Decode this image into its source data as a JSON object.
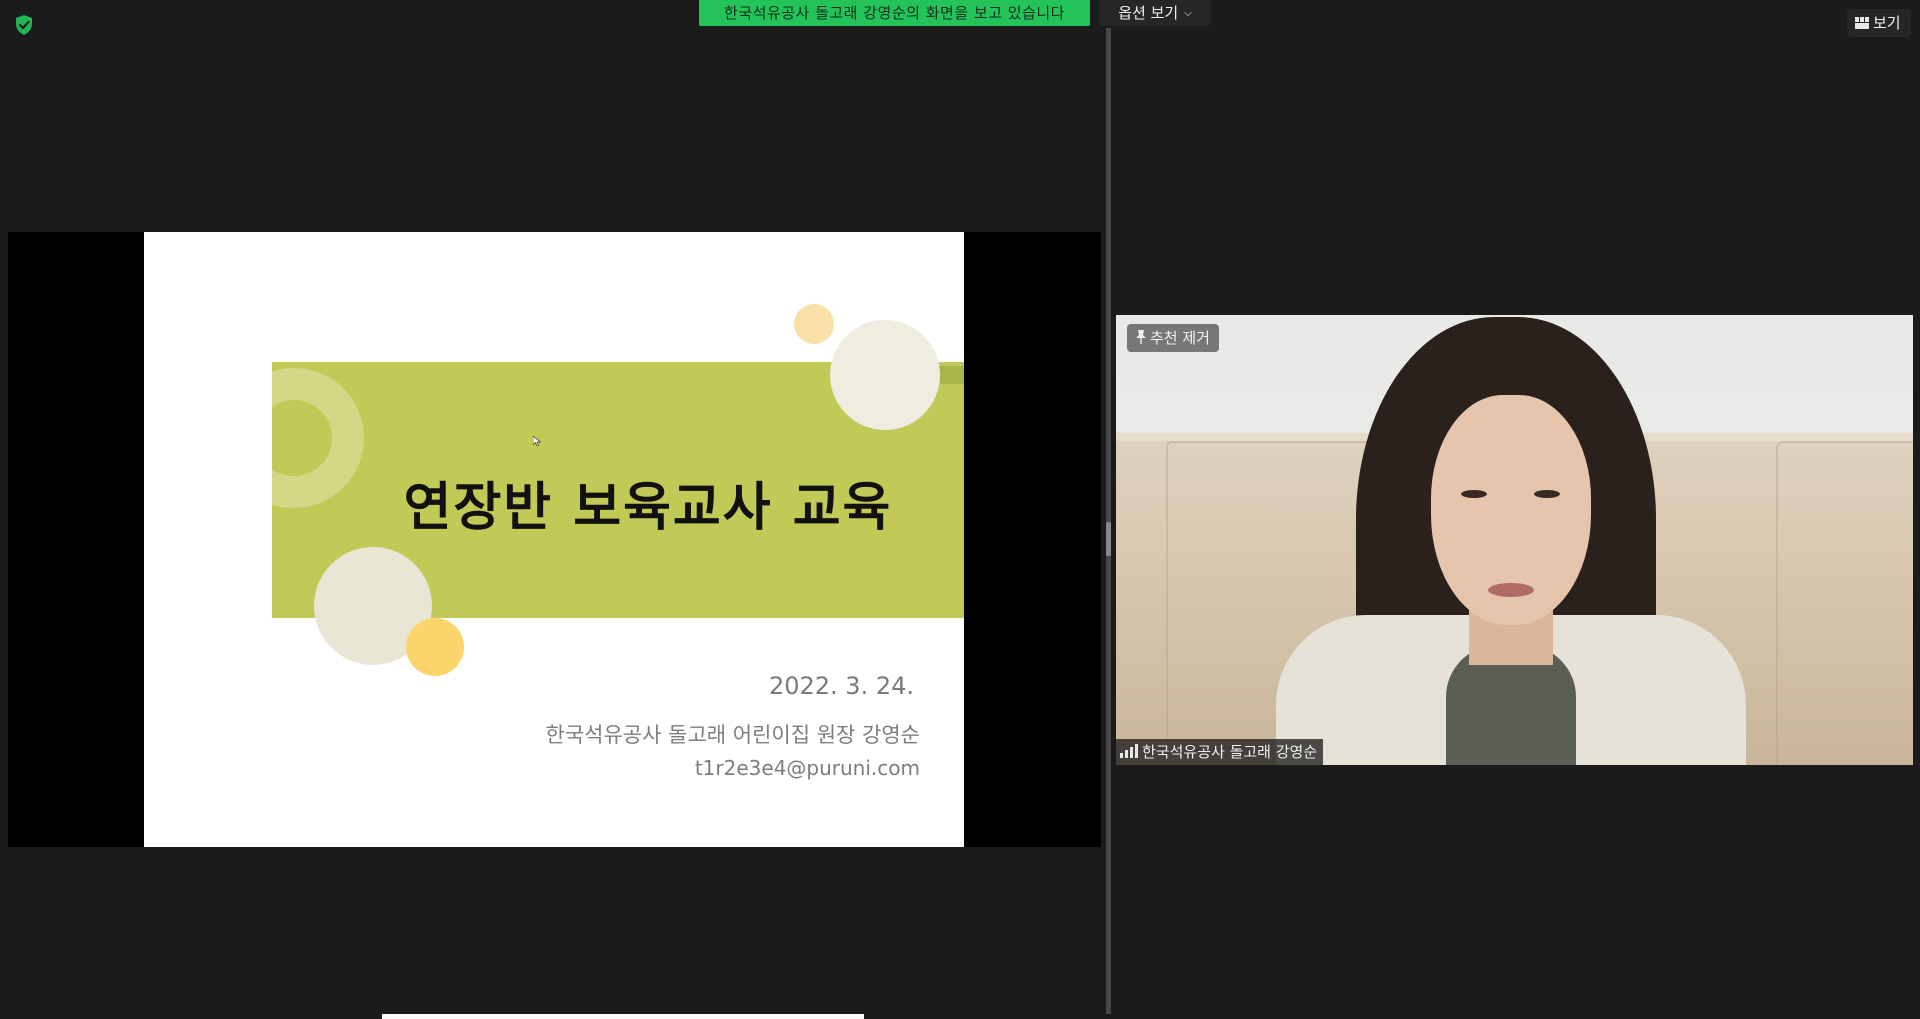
{
  "top_bar": {
    "sharing_banner": "한국석유공사 돌고래 강영순의 화면을 보고 있습니다",
    "view_options": "옵션 보기",
    "view_button": "보기"
  },
  "slide": {
    "title": "연장반 보육교사 교육",
    "date": "2022. 3. 24.",
    "author": "한국석유공사 돌고래 어린이집 원장 강영순",
    "email": "t1r2e3e4@puruni.com"
  },
  "video": {
    "pin_badge": "추천 제거",
    "participant_name": "한국석유공사 돌고래 강영순"
  },
  "colors": {
    "banner_green": "#24c35a",
    "band_green": "#c1c957",
    "background": "#1b1b1b"
  },
  "icons": {
    "security": "shield-check-icon",
    "view": "grid-icon",
    "chevron": "chevron-down-icon",
    "pin": "pin-icon",
    "signal": "signal-bars-icon"
  }
}
